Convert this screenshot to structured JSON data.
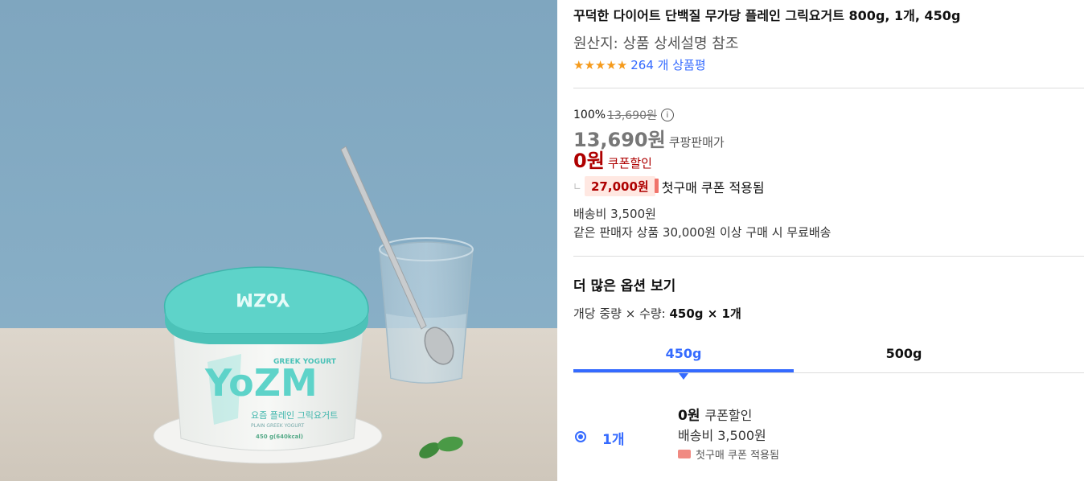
{
  "product": {
    "title": "꾸덕한 다이어트 단백질 무가당 플레인 그릭요거트 800g, 1개, 450g",
    "origin": "원산지: 상품 상세설명 참조",
    "rating_stars": 5,
    "review_text": "264 개 상품평"
  },
  "image": {
    "brand_logo": "YoZM",
    "tagline": "GREEK YOGURT",
    "korean_label": "요즘 플레인 그릭요거트",
    "sub_label": "PLAIN GREEK YOGURT",
    "weight_label": "450 g(640kcal)",
    "lid_text": "YoZM"
  },
  "price": {
    "discount_pct": "100%",
    "original_price": "13,690원",
    "sale_price": "13,690원",
    "sale_label": "쿠팡판매가",
    "coupon_price": "0원",
    "coupon_label": "쿠폰할인",
    "first_coupon_amount": "27,000원",
    "first_coupon_text": "첫구매 쿠폰 적용됨",
    "shipping": "배송비 3,500원",
    "free_shipping": "같은 판매자 상품 30,000원 이상 구매 시 무료배송"
  },
  "options": {
    "more_title": "더 많은 옵션 보기",
    "option_label_prefix": "개당 중량 × 수량: ",
    "option_label_value": "450g × 1개",
    "tabs": [
      {
        "label": "450g",
        "active": true
      },
      {
        "label": "500g",
        "active": false
      }
    ],
    "row": {
      "qty": "1개",
      "price": "0원",
      "price_label": "쿠폰할인",
      "shipping": "배송비 3,500원",
      "coupon": "첫구매 쿠폰 적용됨"
    }
  },
  "colors": {
    "accent_blue": "#346aff",
    "price_red": "#ae0000",
    "star_orange": "#f59a1b",
    "lid_teal": "#5ed3c9"
  }
}
